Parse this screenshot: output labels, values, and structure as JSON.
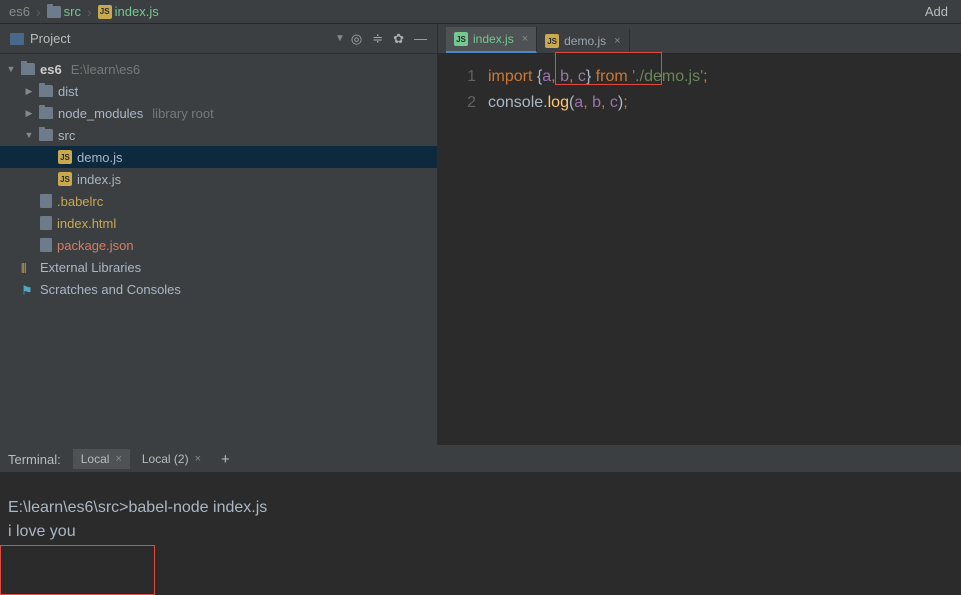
{
  "navbar": {
    "crumbs": [
      "es6",
      "src",
      "index.js"
    ],
    "add": "Add"
  },
  "sidebar": {
    "title": "Project",
    "tree": {
      "root": {
        "name": "es6",
        "path": "E:\\learn\\es6"
      },
      "dist": "dist",
      "node_modules": {
        "name": "node_modules",
        "hint": "library root"
      },
      "src": "src",
      "demo": "demo.js",
      "index": "index.js",
      "babelrc": ".babelrc",
      "indexhtml": "index.html",
      "pkg": "package.json",
      "extlib": "External Libraries",
      "scratch": "Scratches and Consoles"
    }
  },
  "tabs": {
    "t1": "index.js",
    "t2": "demo.js"
  },
  "code": {
    "l1": "1",
    "l2": "2",
    "import": "import",
    "lb": "{",
    "a": "a",
    "b": "b",
    "c": "c",
    "rb": "}",
    "from": "from",
    "path": "'./demo.js'",
    "semi": ";",
    "console": "console",
    "dot": ".",
    "log": "log",
    "lp": "(",
    "rp": ")",
    "comma": ","
  },
  "terminal": {
    "label": "Terminal:",
    "tab1": "Local",
    "tab2": "Local (2)",
    "prompt": "E:\\learn\\es6\\src>",
    "cmd": "babel-node index.js",
    "out": "i love you"
  }
}
